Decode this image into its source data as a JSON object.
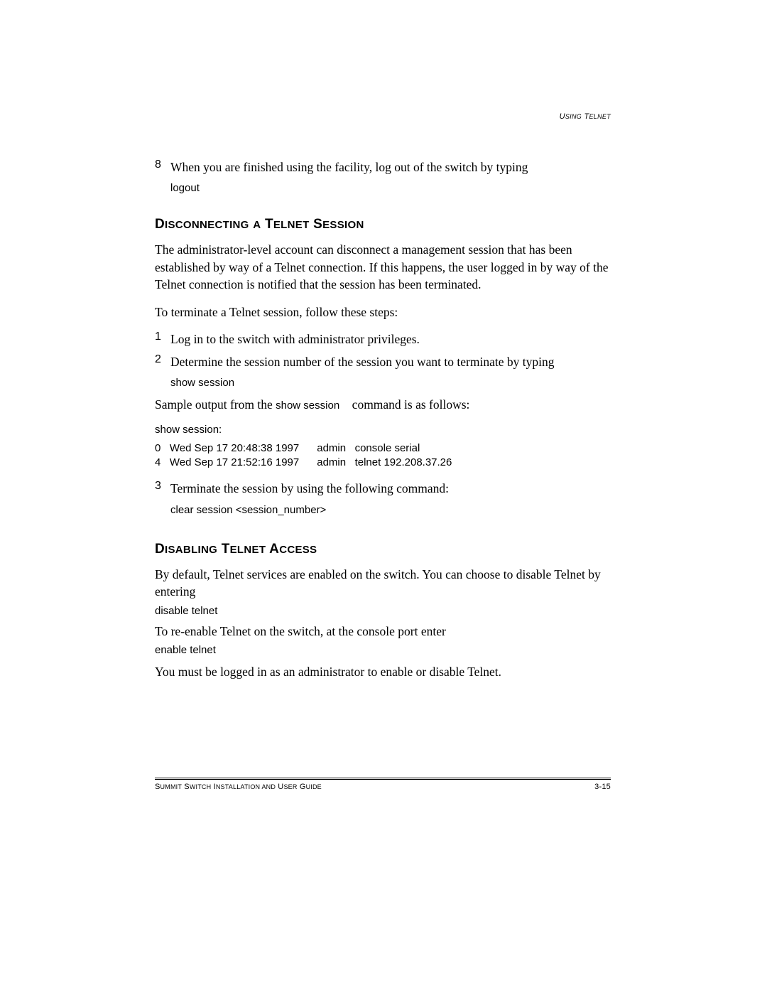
{
  "header": {
    "right": "USING TELNET"
  },
  "step8": {
    "num": "8",
    "text": "When you are finished using the facility, log out of the switch by typing",
    "cmd": "logout"
  },
  "section1": {
    "heading_parts": [
      "D",
      "ISCONNECTING",
      " ",
      "A",
      " T",
      "ELNET",
      " S",
      "ESSION"
    ],
    "para1": "The administrator-level account can disconnect a management session that has been established by way of a Telnet connection. If this happens, the user logged in by way of the Telnet connection is notified that the session has been terminated.",
    "para2": "To terminate a Telnet session, follow these steps:",
    "step1": {
      "num": "1",
      "text": "Log in to the switch with administrator privileges."
    },
    "step2": {
      "num": "2",
      "text": "Determine the session number of the session you want to terminate by typing",
      "cmd": "show session"
    },
    "sample_pre": "Sample output from the ",
    "sample_cmd": "show session",
    "sample_post": " command is as follows:",
    "show_header": "show session:",
    "show_output": "0   Wed Sep 17 20:48:38 1997      admin   console serial\n4   Wed Sep 17 21:52:16 1997      admin   telnet 192.208.37.26",
    "step3": {
      "num": "3",
      "text": "Terminate the session by using the following command:",
      "cmd": "clear session <session_number>"
    }
  },
  "section2": {
    "heading_parts": [
      "D",
      "ISABLING",
      " T",
      "ELNET",
      " A",
      "CCESS"
    ],
    "para1": "By default, Telnet services are enabled on the switch. You can choose to disable Telnet by entering",
    "cmd1": "disable telnet",
    "para2": "To re-enable Telnet on the switch, at the console port enter",
    "cmd2": "enable telnet",
    "para3": "You must be logged in as an administrator to enable or disable Telnet."
  },
  "footer": {
    "left": "SUMMIT SWITCH INSTALLATION AND USER GUIDE",
    "right": "3-15"
  }
}
